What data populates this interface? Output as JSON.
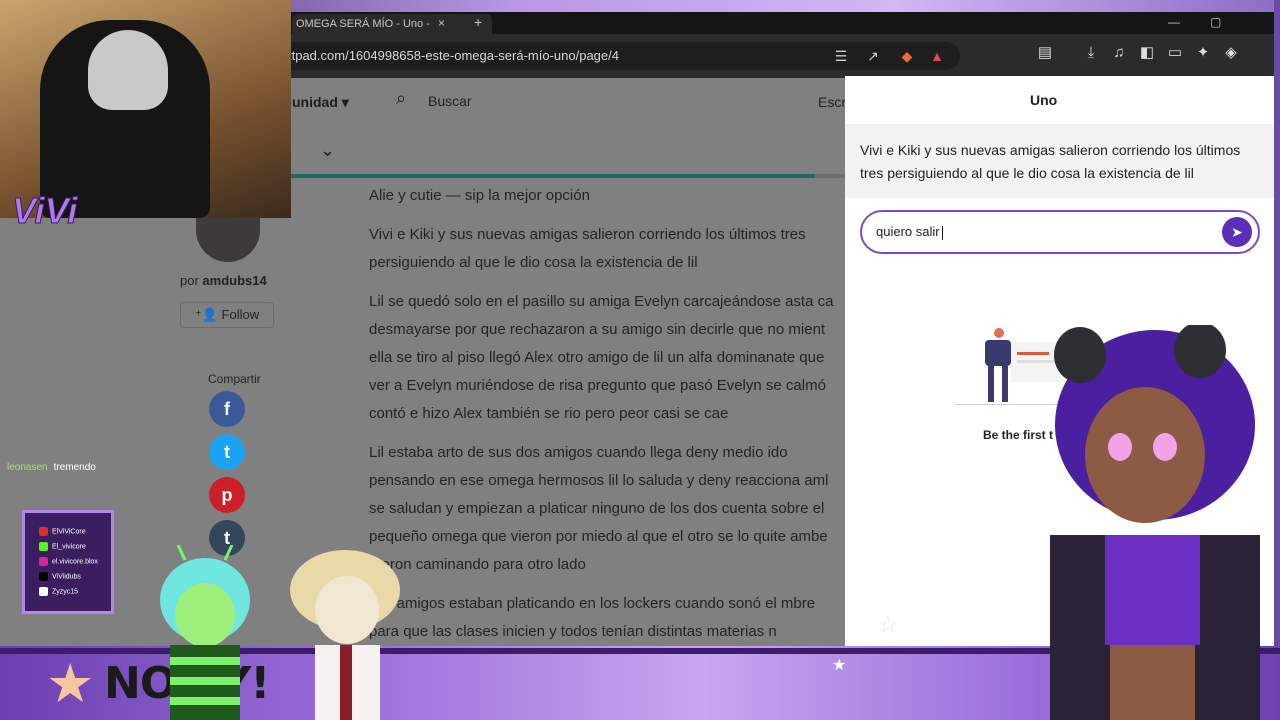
{
  "browser": {
    "tab_title": "OMEGA SERÁ MÍO - Uno -",
    "tab_close": "×",
    "tab_new": "+",
    "url": "ttpad.com/1604998658-este-omega-será-mío-uno/page/4"
  },
  "site_nav": {
    "community_label": "unidad",
    "search_label": "Buscar",
    "write_label": "Escr"
  },
  "author": {
    "by_prefix": "por",
    "name": "amdubs14",
    "follow_label": "Follow",
    "share_label": "Compartir"
  },
  "story": {
    "paragraphs": [
      "Alie y cutie — sip la mejor opción",
      "Vivi e Kiki y sus nuevas amigas salieron corriendo los últimos tres persiguiendo al que le dio cosa la existencia de lil",
      "Lil se quedó solo en el pasillo su amiga Evelyn carcajeándose asta ca desmayarse por que rechazaron a su amigo sin decirle que no mient ella se tiro al piso llegó Alex otro amigo de lil un alfa dominanate que ver a Evelyn muriéndose de risa pregunto que pasó Evelyn se calmó contó e hizo Alex también se rio pero peor casi se cae",
      "Lil estaba arto de sus dos amigos cuando llega deny medio ido pensando en ese omega hermosos lil lo saluda y deny reacciona aml se saludan y empiezan a platicar ninguno de los dos cuenta sobre el pequeño omega que vieron por miedo al que el otro se lo quite ambe fueron caminando para otro lado",
      "sus amigos estaban platicando en los lockers cuando sonó el mbre para que las clases inicien y todos tenían distintas materias n"
    ]
  },
  "comments_panel": {
    "title": "Uno",
    "quoted_text": "Vivi e Kiki y sus nuevas amigas salieron corriendo los últimos tres persiguiendo al que le dio cosa la existencia de lil",
    "input_value": "quiero salir",
    "empty_state": "Be the first t"
  },
  "overlay": {
    "chat": {
      "user": "leonasen",
      "message": "tremendo"
    },
    "logo": "ViVi",
    "socials": [
      "ElViViCore",
      "El_vivicore",
      "el.vivicore.blox",
      "ViViidubs",
      "Zyzyc15"
    ],
    "ticker": "NO        AY!"
  },
  "colors": {
    "accent_purple": "#5b2fb8",
    "progress_teal": "#1f6b5e",
    "facebook": "#3b5998",
    "twitter": "#1da1f2",
    "pinterest": "#cb2027",
    "tumblr": "#35465c"
  }
}
